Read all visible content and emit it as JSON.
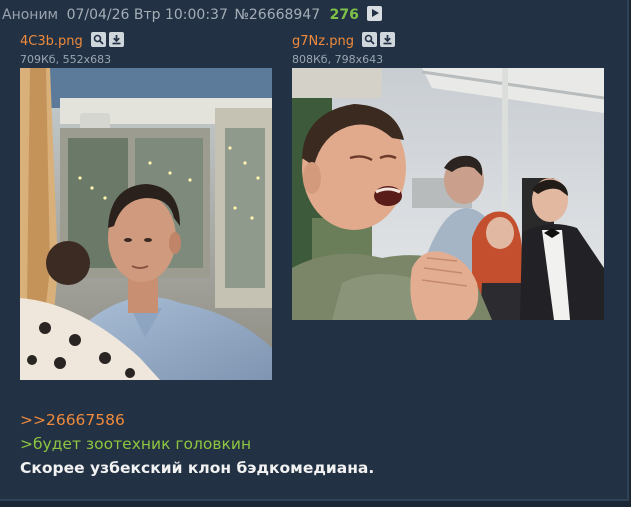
{
  "header": {
    "name": "Аноним",
    "date": "07/04/26 Втр 10:00:37",
    "post_number": "№26668947",
    "reply_count": "276"
  },
  "files": [
    {
      "name": "4C3b.png",
      "meta": "709Кб, 552x683",
      "image": "photo-man-at-restaurant"
    },
    {
      "name": "g7Nz.png",
      "meta": "808Кб, 798x643",
      "image": "photo-man-singing-at-party"
    }
  ],
  "post": {
    "reply_link": ">>26667586",
    "greentext": ">будет зоотехник головкин",
    "text": "Скорее узбекский клон бэдкомедиана."
  },
  "colors": {
    "background": "#223244",
    "accent_orange": "#f08a3c",
    "greentext": "#8ec63f",
    "reply_count": "#7ec14a"
  },
  "icons": [
    "search-icon",
    "download-icon",
    "play-icon"
  ]
}
